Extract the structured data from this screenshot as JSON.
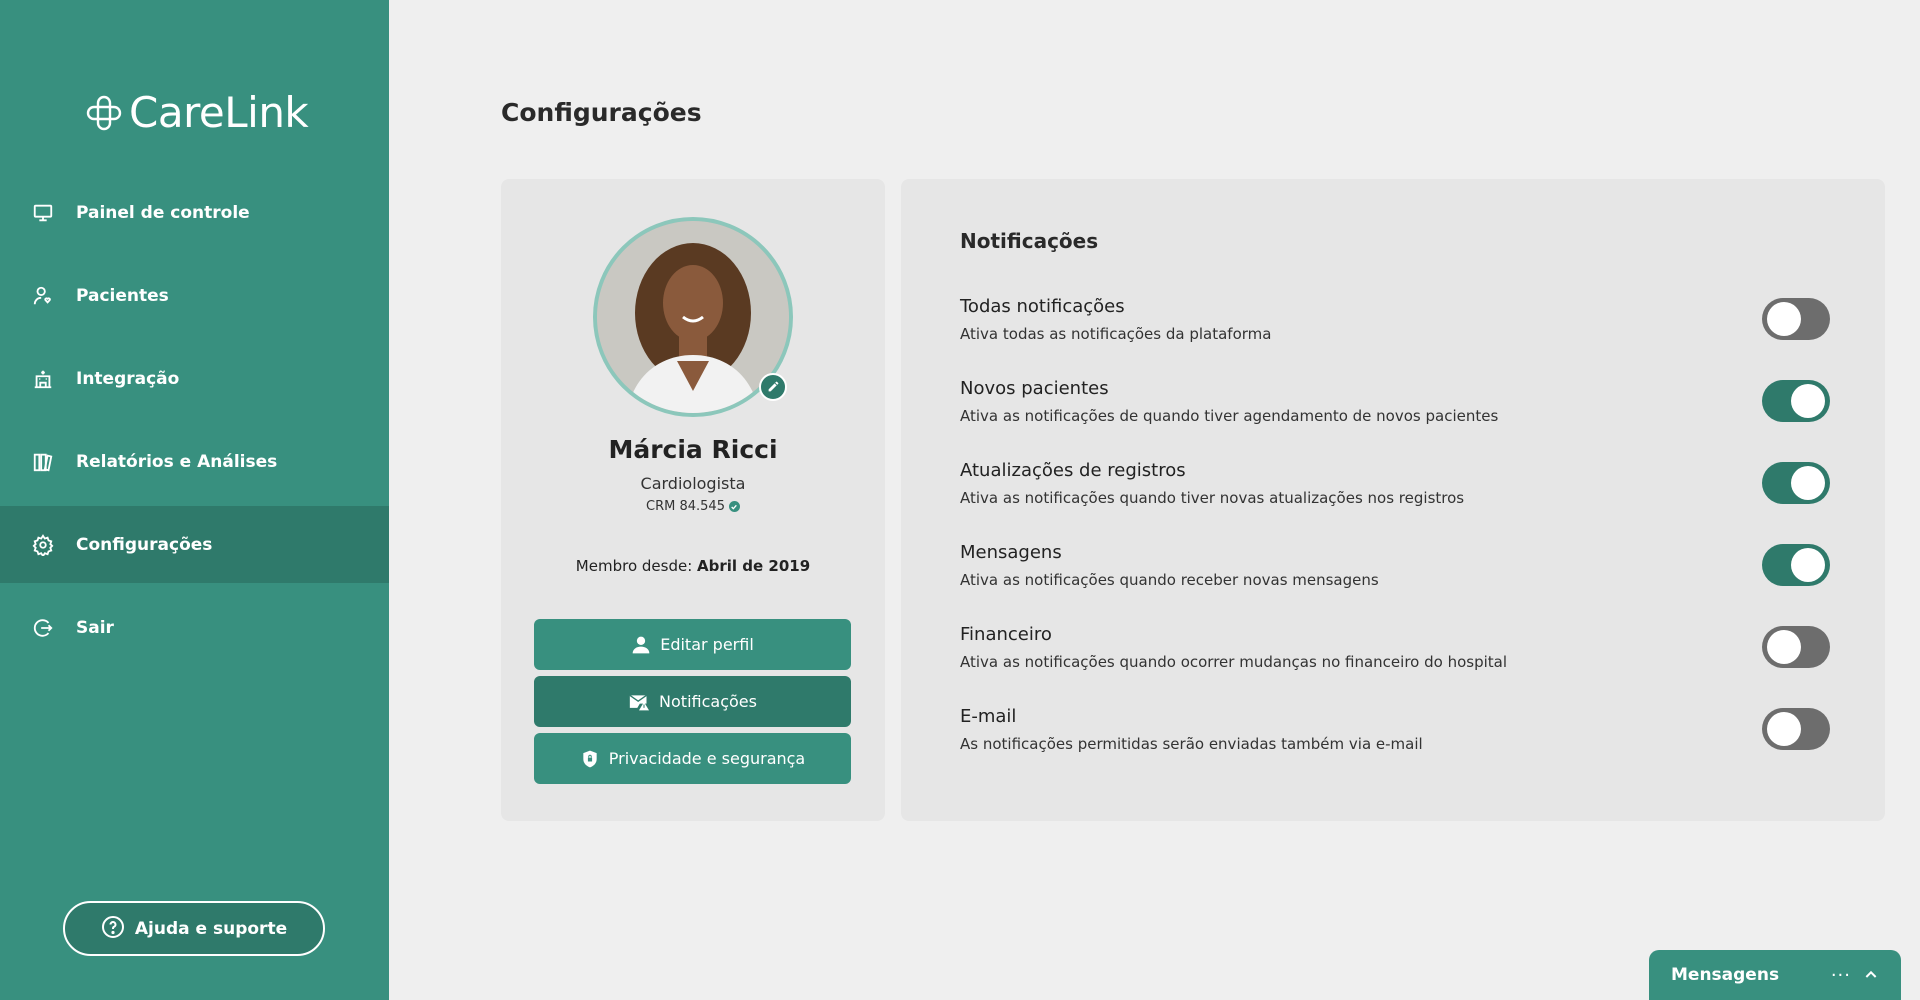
{
  "app": {
    "name": "CareLink"
  },
  "sidebar": {
    "items": [
      {
        "label": "Painel de controle",
        "icon": "monitor-icon"
      },
      {
        "label": "Pacientes",
        "icon": "patient-icon"
      },
      {
        "label": "Integração",
        "icon": "hospital-icon"
      },
      {
        "label": "Relatórios e Análises",
        "icon": "reports-icon"
      },
      {
        "label": "Configurações",
        "icon": "gear-icon",
        "active": true
      },
      {
        "label": "Sair",
        "icon": "logout-icon"
      }
    ],
    "help_label": "Ajuda e suporte"
  },
  "page": {
    "title": "Configurações"
  },
  "profile": {
    "name": "Márcia Ricci",
    "role": "Cardiologista",
    "crm": "CRM 84.545",
    "member_since_label": "Membro desde:",
    "member_since_value": "Abril de 2019",
    "buttons": {
      "edit": "Editar perfil",
      "notifications": "Notificações",
      "privacy": "Privacidade e segurança"
    }
  },
  "notifications": {
    "heading": "Notificações",
    "items": [
      {
        "title": "Todas notificações",
        "desc": "Ativa todas as notificações da plataforma",
        "enabled": false
      },
      {
        "title": "Novos pacientes",
        "desc": "Ativa as notificações de quando tiver agendamento de novos pacientes",
        "enabled": true
      },
      {
        "title": "Atualizações de registros",
        "desc": "Ativa as notificações quando tiver novas atualizações nos registros",
        "enabled": true
      },
      {
        "title": "Mensagens",
        "desc": "Ativa as notificações quando receber novas mensagens",
        "enabled": true
      },
      {
        "title": "Financeiro",
        "desc": "Ativa as notificações quando ocorrer mudanças no financeiro do hospital",
        "enabled": false
      },
      {
        "title": "E-mail",
        "desc": "As notificações permitidas serão enviadas também via e-mail",
        "enabled": false
      }
    ]
  },
  "messages_bar": {
    "label": "Mensagens",
    "more": "···"
  },
  "colors": {
    "primary": "#38907f",
    "primary_dark": "#2f7a6b",
    "toggle_off": "#6d6d6d",
    "background": "#efefef",
    "card": "#e6e6e6"
  }
}
